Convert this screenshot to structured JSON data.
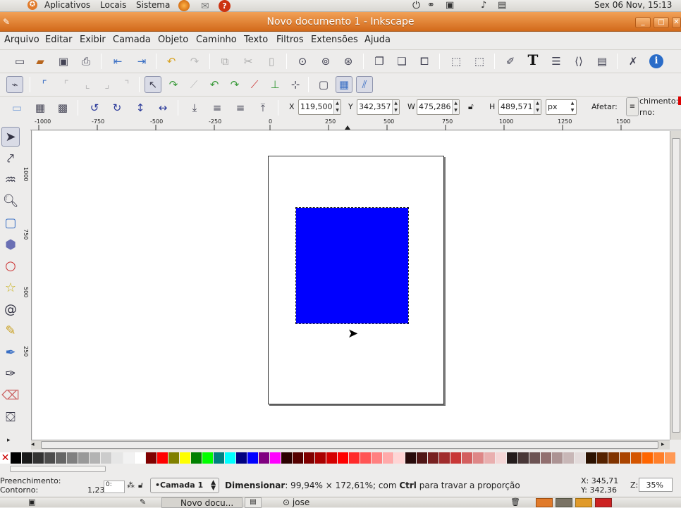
{
  "top_panel": {
    "menus": [
      "Aplicativos",
      "Locais",
      "Sistema"
    ],
    "clock": "Sex 06 Nov, 15:13"
  },
  "window": {
    "title": "Novo documento 1 - Inkscape"
  },
  "menubar": {
    "items": [
      "Arquivo",
      "Editar",
      "Exibir",
      "Camada",
      "Objeto",
      "Caminho",
      "Texto",
      "Filtros",
      "Extensões",
      "Ajuda"
    ]
  },
  "toolbar3": {
    "x_label": "X",
    "x_value": "119,500",
    "y_label": "Y",
    "y_value": "342,357",
    "w_label": "W",
    "w_value": "475,286",
    "h_label": "H",
    "h_value": "489,571",
    "unit": "px",
    "affect_label": "Afetar:",
    "affect_line1": "chimento:",
    "affect_line2": "rno:"
  },
  "hruler": {
    "ticks": [
      "-1000",
      "-750",
      "-500",
      "-250",
      "0",
      "250",
      "500",
      "750",
      "1000",
      "1250",
      "1500"
    ]
  },
  "vruler": {
    "ticks": [
      "1000",
      "750",
      "500",
      "250"
    ]
  },
  "colors": {
    "selected_fill": "#0000ff",
    "titlebar": "#e07a2a",
    "palette": [
      "#000000",
      "#1a1a1a",
      "#333333",
      "#4d4d4d",
      "#666666",
      "#808080",
      "#999999",
      "#b3b3b3",
      "#cccccc",
      "#e6e6e6",
      "#f2f2f2",
      "#ffffff",
      "#800000",
      "#ff0000",
      "#808000",
      "#ffff00",
      "#008000",
      "#00ff00",
      "#008080",
      "#00ffff",
      "#000080",
      "#0000ff",
      "#800080",
      "#ff00ff",
      "#2b0000",
      "#550000",
      "#800000",
      "#aa0000",
      "#d40000",
      "#ff0000",
      "#ff2a2a",
      "#ff5555",
      "#ff8080",
      "#ffaaaa",
      "#ffd5d5",
      "#280b0b",
      "#501616",
      "#782121",
      "#a02c2c",
      "#c83737",
      "#d35f5f",
      "#de8787",
      "#e9afaf",
      "#f4d7d7",
      "#241c1c",
      "#483737",
      "#6c5353",
      "#916f6f",
      "#ac9393",
      "#c8b7b7",
      "#e3dbdb",
      "#2b1100",
      "#552200",
      "#803300",
      "#aa4400",
      "#d45500",
      "#ff6600",
      "#ff7f2a",
      "#ff9955"
    ]
  },
  "statusbar": {
    "fill_label": "Preenchimento:",
    "stroke_label": "Contorno:",
    "stroke_width": "1,23",
    "layer": "•Camada 1",
    "message_bold": "Dimensionar",
    "message": ": 99,94% × 172,61%; com ",
    "message_key": "Ctrl",
    "message_end": " para travar a proporção",
    "cursor_x": "X:  345,71",
    "cursor_y": "Y:  342,36",
    "zoom_label": "Z:",
    "zoom": "35%"
  },
  "taskbar": {
    "item1": "Novo docu...",
    "item2": "jose"
  }
}
